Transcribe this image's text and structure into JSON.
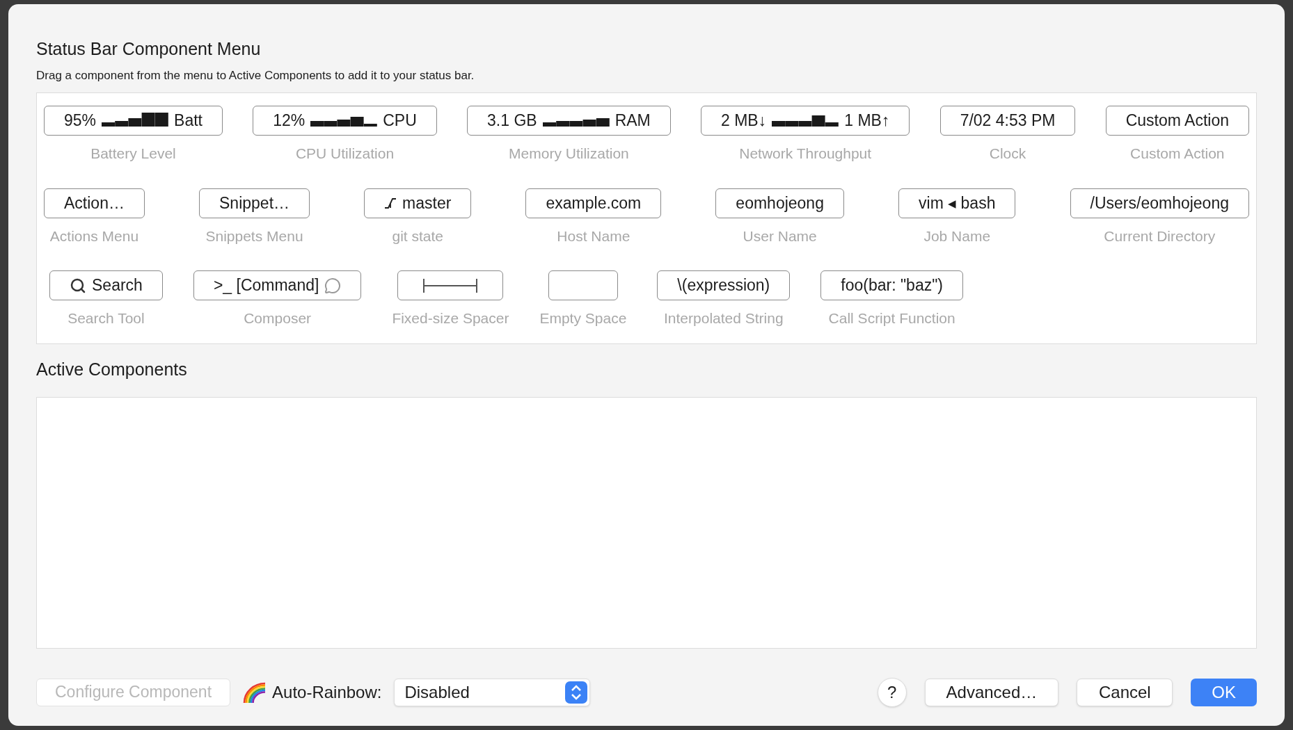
{
  "dialog": {
    "title": "Status Bar Component Menu",
    "subtitle": "Drag a component from the menu to Active Components to add it to your status bar."
  },
  "menu_rows": [
    [
      {
        "kind": "sparkline",
        "prefix": "95%",
        "suffix": "Batt",
        "label": "Battery Level"
      },
      {
        "kind": "sparkline",
        "prefix": "12%",
        "suffix": "CPU",
        "label": "CPU Utilization"
      },
      {
        "kind": "sparkline",
        "prefix": "3.1 GB",
        "suffix": "RAM",
        "label": "Memory Utilization"
      },
      {
        "kind": "sparkline",
        "prefix": "2 MB↓",
        "suffix": "1 MB↑",
        "label": "Network Throughput"
      },
      {
        "kind": "text",
        "text": "7/02 4:53 PM",
        "label": "Clock"
      },
      {
        "kind": "text",
        "text": "Custom Action",
        "label": "Custom Action"
      }
    ],
    [
      {
        "kind": "text",
        "text": "Action…",
        "label": "Actions Menu"
      },
      {
        "kind": "text",
        "text": "Snippet…",
        "label": "Snippets Menu"
      },
      {
        "kind": "git",
        "text": "master",
        "label": "git state"
      },
      {
        "kind": "text",
        "text": "example.com",
        "label": "Host Name"
      },
      {
        "kind": "text",
        "text": "eomhojeong",
        "label": "User Name"
      },
      {
        "kind": "text",
        "text": "vim ◂ bash",
        "label": "Job Name"
      },
      {
        "kind": "text",
        "text": "/Users/eomhojeong",
        "label": "Current Directory"
      }
    ],
    [
      {
        "kind": "search",
        "text": "Search",
        "label": "Search Tool"
      },
      {
        "kind": "composer",
        "text": ">_ [Command]",
        "label": "Composer"
      },
      {
        "kind": "spacer",
        "label": "Fixed-size Spacer"
      },
      {
        "kind": "empty",
        "label": "Empty Space"
      },
      {
        "kind": "text",
        "text": "\\(expression)",
        "label": "Interpolated String"
      },
      {
        "kind": "text",
        "text": "foo(bar: \"baz\")",
        "label": "Call Script Function"
      }
    ]
  ],
  "active_components": {
    "title": "Active Components"
  },
  "footer": {
    "configure_button": {
      "label": "Configure Component",
      "disabled": true
    },
    "auto_rainbow": {
      "label": "Auto-Rainbow:",
      "value": "Disabled"
    },
    "help_button": "?",
    "buttons": [
      {
        "label": "Advanced…",
        "default": false
      },
      {
        "label": "Cancel",
        "default": false
      },
      {
        "label": "OK",
        "default": true
      }
    ]
  }
}
